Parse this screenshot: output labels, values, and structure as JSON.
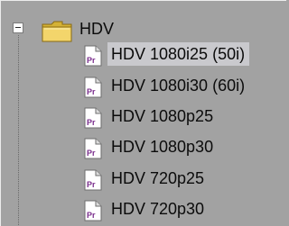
{
  "tree": {
    "folder": {
      "label": "HDV",
      "expanded": true,
      "icon": "folder-icon"
    },
    "items": [
      {
        "label": "HDV 1080i25 (50i)",
        "icon": "premiere-preset-icon",
        "selected": true
      },
      {
        "label": "HDV 1080i30 (60i)",
        "icon": "premiere-preset-icon",
        "selected": false
      },
      {
        "label": "HDV 1080p25",
        "icon": "premiere-preset-icon",
        "selected": false
      },
      {
        "label": "HDV 1080p30",
        "icon": "premiere-preset-icon",
        "selected": false
      },
      {
        "label": "HDV 720p25",
        "icon": "premiere-preset-icon",
        "selected": false
      },
      {
        "label": "HDV 720p30",
        "icon": "premiere-preset-icon",
        "selected": false
      }
    ]
  },
  "icon_text": "Pr",
  "colors": {
    "background": "#a2a2a2",
    "selection": "#c9c9cd",
    "folder_fill": "#f3d56b",
    "icon_text": "#7a2d8c"
  }
}
